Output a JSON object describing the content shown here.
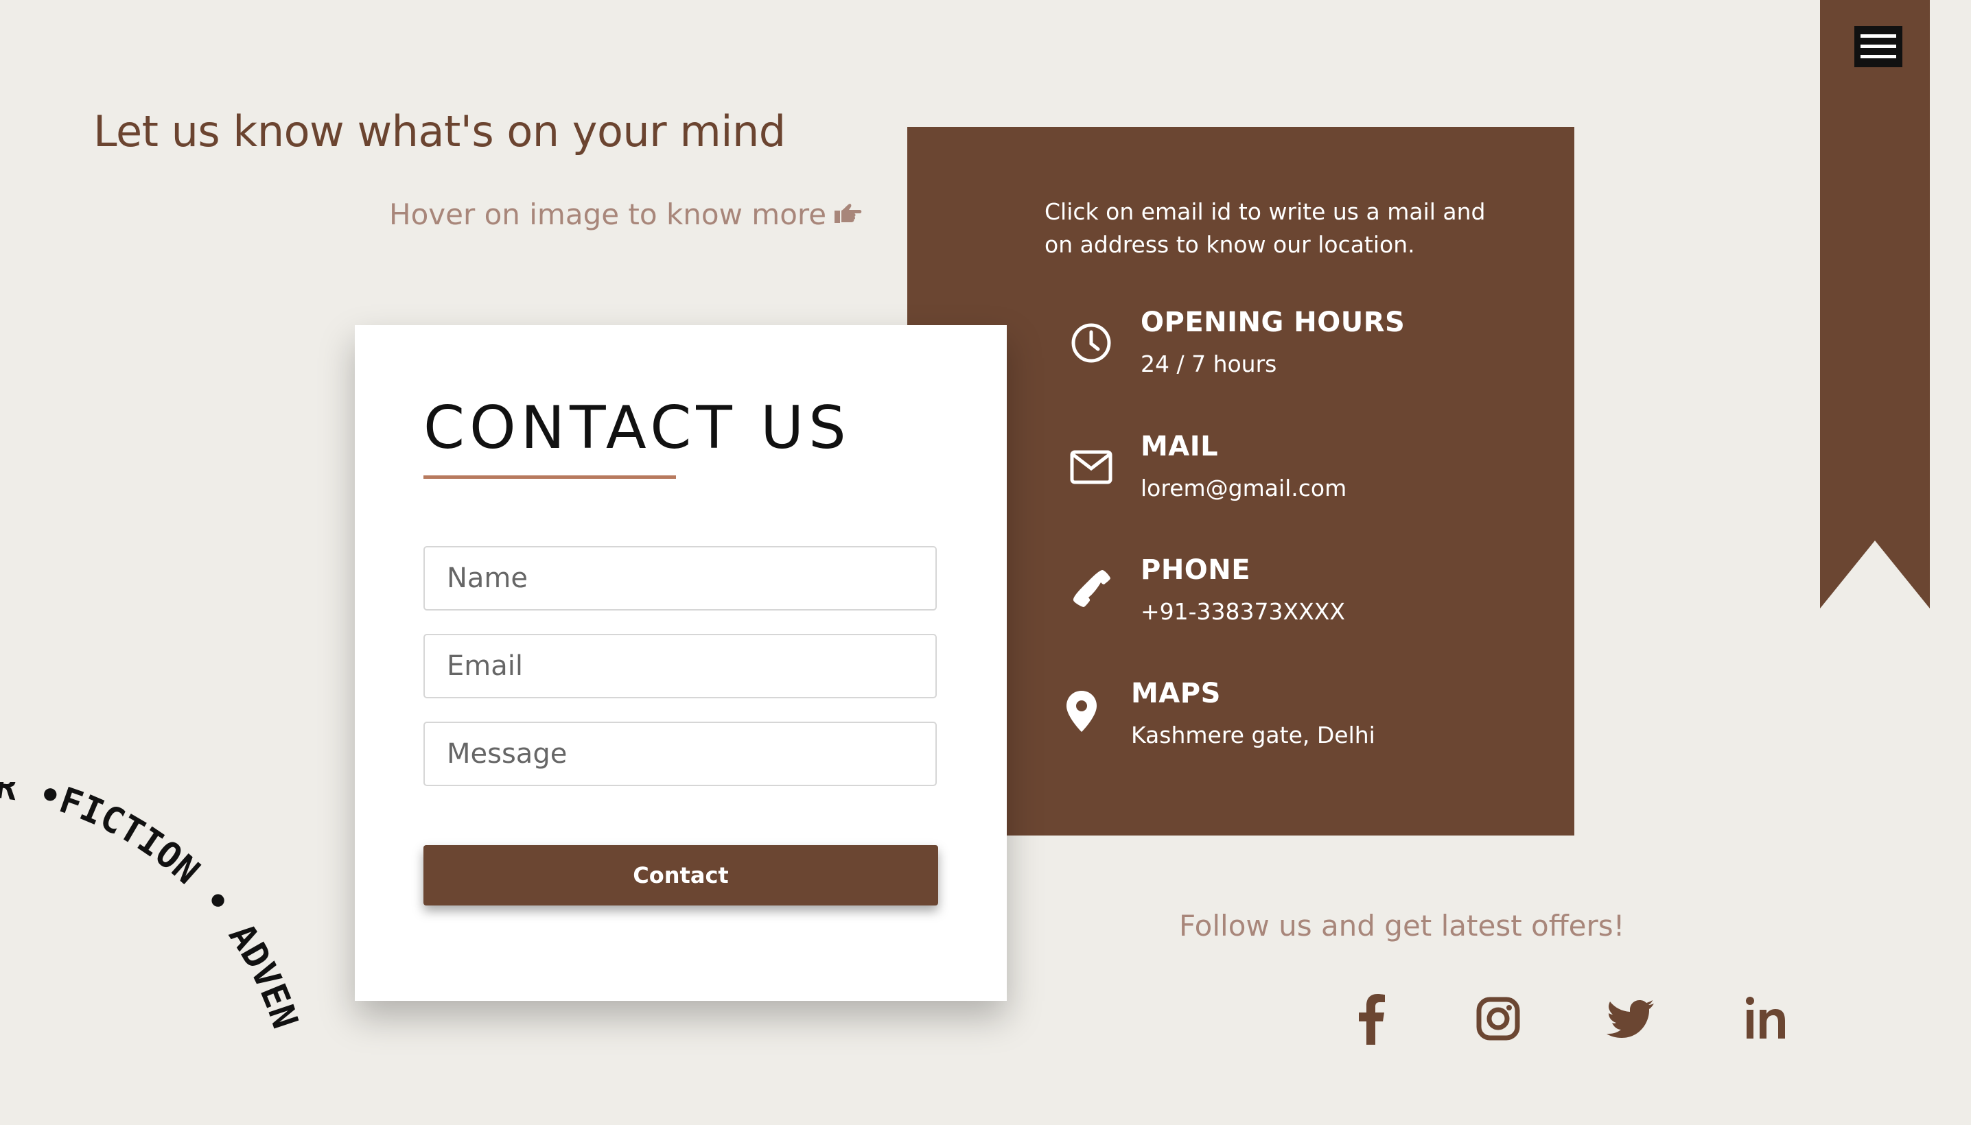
{
  "heading": "Let us know what's on your mind",
  "hover_hint": "Hover on image to know more",
  "info": {
    "intro": "Click on email id to write us a mail and on address to know our location.",
    "items": [
      {
        "title": "OPENING HOURS",
        "value": "24 / 7 hours",
        "icon": "clock-icon"
      },
      {
        "title": "MAIL",
        "value": "lorem@gmail.com",
        "icon": "mail-icon"
      },
      {
        "title": "PHONE",
        "value": "+91-338373XXXX",
        "icon": "phone-icon"
      },
      {
        "title": "MAPS",
        "value": "Kashmere gate, Delhi",
        "icon": "map-pin-icon"
      }
    ]
  },
  "form": {
    "title": "CONTACT US",
    "name_placeholder": "Name",
    "email_placeholder": "Email",
    "message_placeholder": "Message",
    "button_label": "Contact"
  },
  "follow_text": "Follow us and get latest offers!",
  "social": [
    "facebook-icon",
    "instagram-icon",
    "twitter-icon",
    "linkedin-icon"
  ],
  "circular_text": "OR •FICTION • ADVEN",
  "colors": {
    "background": "#efede8",
    "brand": "#6b4632",
    "accent": "#b77a5e",
    "muted": "#a8867a"
  }
}
